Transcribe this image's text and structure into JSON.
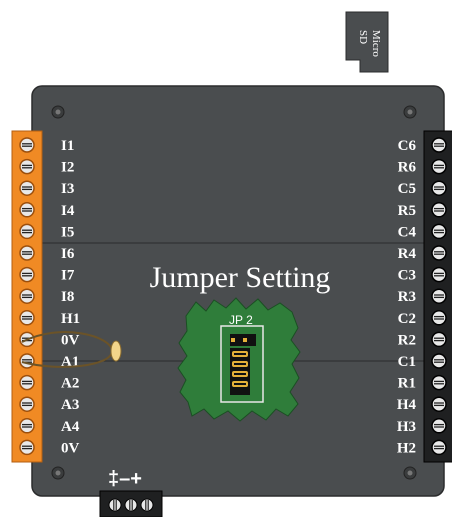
{
  "sd_card": {
    "label_line1": "Micro",
    "label_line2": "SD"
  },
  "title": "Jumper Setting",
  "jumper": {
    "label": "JP 2"
  },
  "left_terminals": [
    "I1",
    "I2",
    "I3",
    "I4",
    "I5",
    "I6",
    "I7",
    "I8",
    "H1",
    "0V",
    "A1",
    "A2",
    "A3",
    "A4",
    "0V"
  ],
  "right_terminals": [
    "C6",
    "R6",
    "C5",
    "R5",
    "C4",
    "R4",
    "C3",
    "R3",
    "C2",
    "R2",
    "C1",
    "R1",
    "H4",
    "H3",
    "H2"
  ],
  "power_symbols": "‡–+",
  "colors": {
    "board": "#4a4d4f",
    "board_edge": "#2b2c2d",
    "orange_terminal": "#f08a24",
    "black_terminal": "#1f2021",
    "pcb_green": "#2f7d3a",
    "wire": "#8a6b2e"
  }
}
